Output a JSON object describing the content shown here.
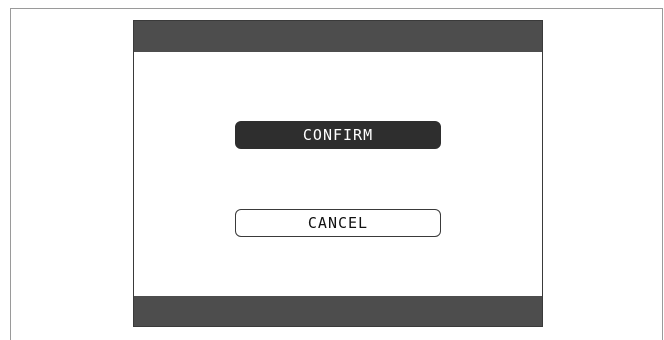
{
  "dialog": {
    "confirm_label": "CONFIRM",
    "cancel_label": "CANCEL"
  },
  "colors": {
    "bar": "#4d4d4d",
    "confirm_bg": "#2e2e2e",
    "confirm_text": "#ffffff",
    "cancel_bg": "#ffffff",
    "cancel_text": "#111111"
  }
}
